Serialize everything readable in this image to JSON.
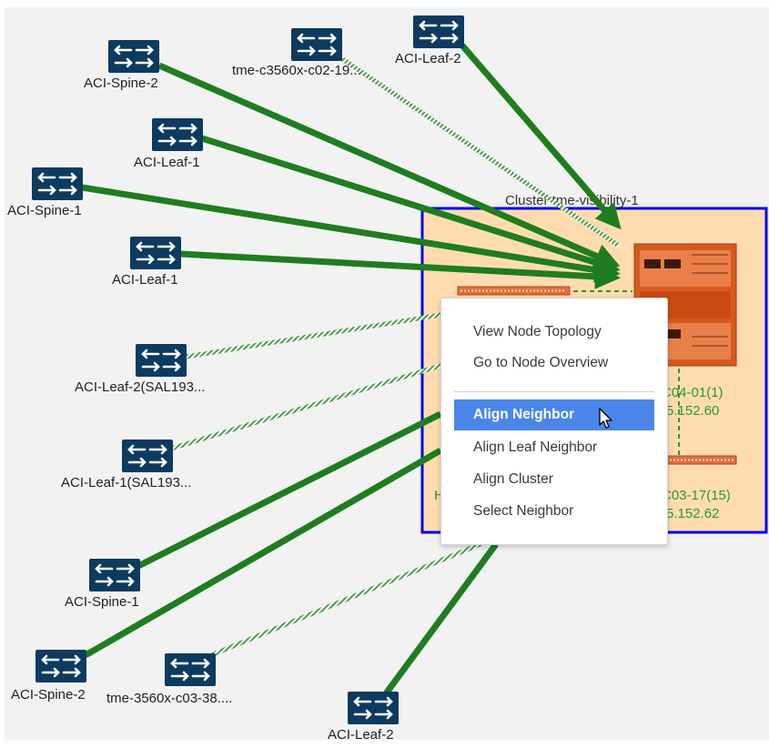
{
  "colors": {
    "canvas_bg": "#f2f2f2",
    "link_green": "#1f7d1f",
    "dotted_link": "#4e9a4e",
    "node_icon": "#0d3a5f",
    "cluster_border": "#0000ee",
    "cluster_fill": "#ffdcb0",
    "label_green": "#2c9a2c",
    "menu_active": "#4a86e8"
  },
  "cluster": {
    "label": "Cluster tme-visibility-1",
    "node_b_label_line1": "C04-01(1)",
    "node_b_label_line2": "5.152.60",
    "node_c_label_line1": "C03-17(15)",
    "node_c_label_line2": "5.152.62",
    "left_partial_label": "H"
  },
  "nodes": [
    {
      "label": "ACI-Spine-2",
      "icon": "switch-icon"
    },
    {
      "label": "tme-c3560x-c02-19...",
      "icon": "switch-icon"
    },
    {
      "label": "ACI-Leaf-2",
      "icon": "switch-icon"
    },
    {
      "label": "ACI-Leaf-1",
      "icon": "switch-icon"
    },
    {
      "label": "ACI-Spine-1",
      "icon": "switch-icon"
    },
    {
      "label": "ACI-Leaf-1",
      "icon": "switch-icon"
    },
    {
      "label": "ACI-Leaf-2(SAL193...",
      "icon": "switch-icon"
    },
    {
      "label": "ACI-Leaf-1(SAL193...",
      "icon": "switch-icon"
    },
    {
      "label": "ACI-Spine-1",
      "icon": "switch-icon"
    },
    {
      "label": "ACI-Spine-2",
      "icon": "switch-icon"
    },
    {
      "label": "tme-3560x-c03-38....",
      "icon": "switch-icon"
    },
    {
      "label": "ACI-Leaf-2",
      "icon": "switch-icon"
    }
  ],
  "context_menu": {
    "items": [
      {
        "label": "View Node Topology"
      },
      {
        "label": "Go to Node Overview"
      },
      {
        "label": "Align Neighbor",
        "active": true
      },
      {
        "label": "Align Leaf Neighbor"
      },
      {
        "label": "Align Cluster"
      },
      {
        "label": "Select Neighbor"
      }
    ]
  }
}
